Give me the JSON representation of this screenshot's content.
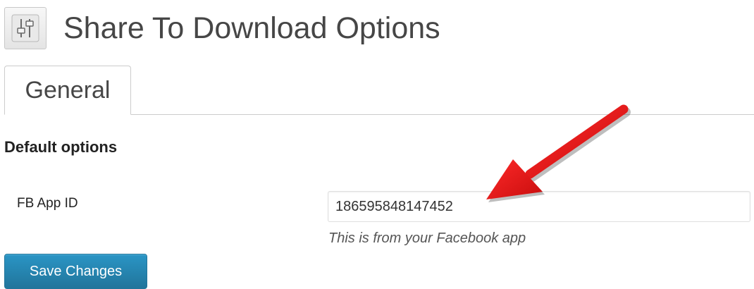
{
  "header": {
    "title": "Share To Download Options",
    "icon": "settings-icon"
  },
  "tabs": [
    {
      "label": "General",
      "active": true
    }
  ],
  "section": {
    "heading": "Default options"
  },
  "fields": {
    "fb_app_id": {
      "label": "FB App ID",
      "value": "186595848147452",
      "description": "This is from your Facebook app"
    }
  },
  "actions": {
    "save_label": "Save Changes"
  },
  "annotation": {
    "icon": "red-arrow-icon",
    "color": "#e0141a"
  },
  "colors": {
    "primary_button": "#21759b",
    "text": "#333333",
    "border": "#cccccc"
  }
}
